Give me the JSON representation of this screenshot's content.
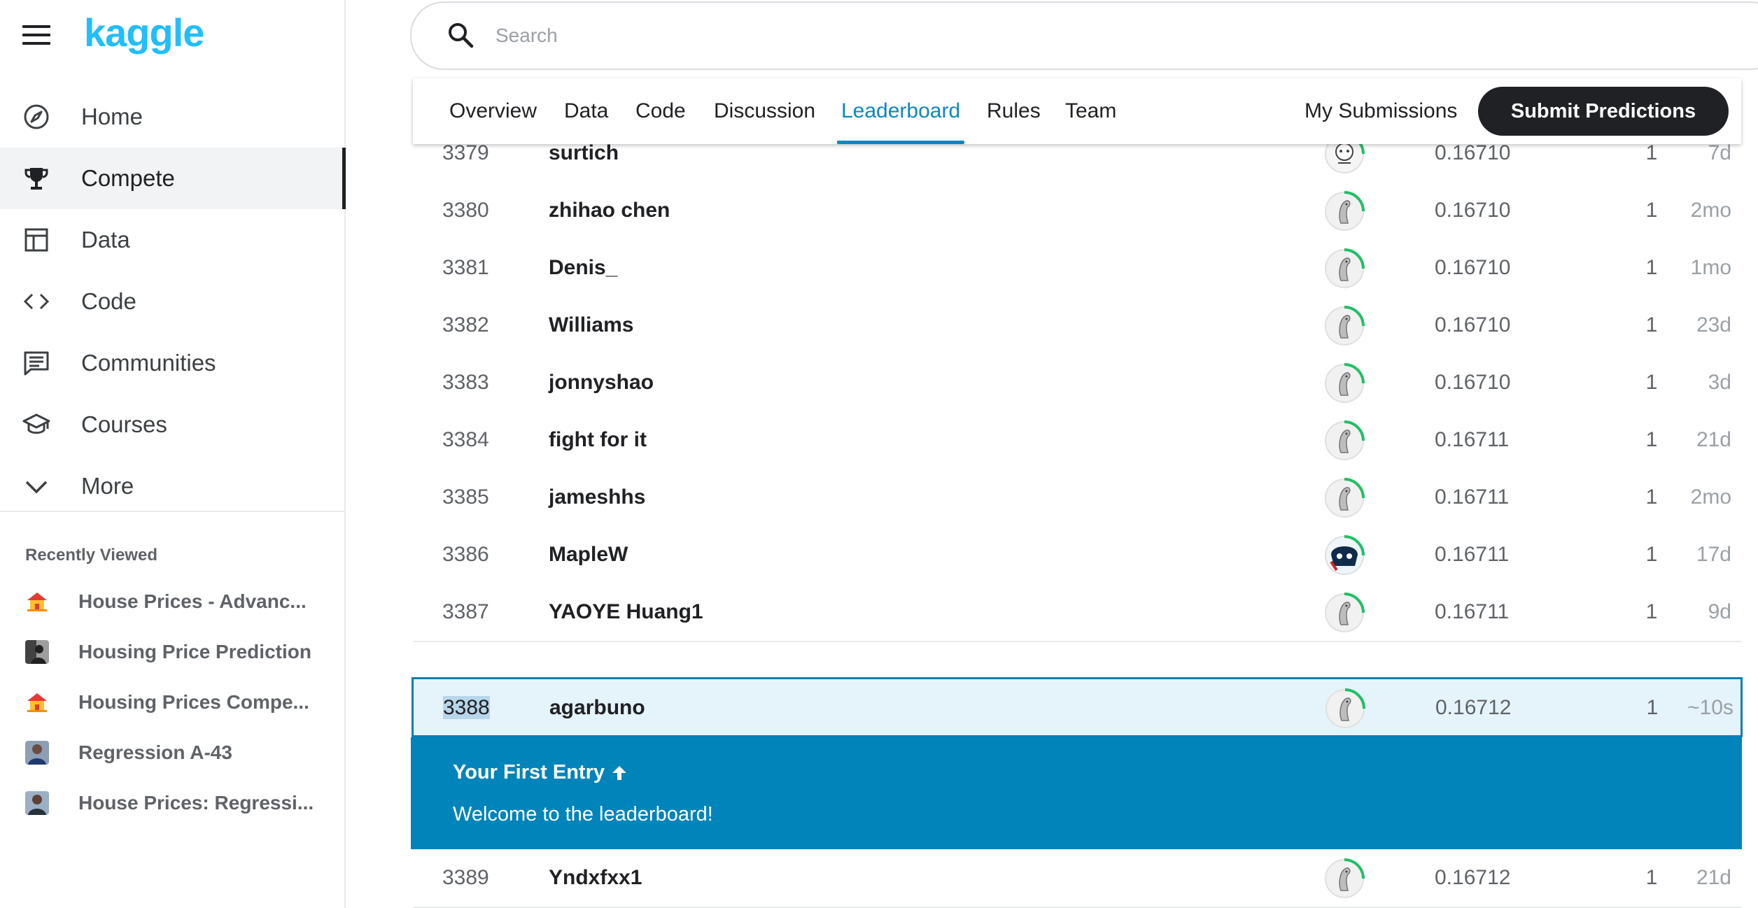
{
  "brand": {
    "logo_text": "kaggle",
    "accent": "#20beff"
  },
  "nav": {
    "items": [
      {
        "label": "Home",
        "icon": "compass-icon"
      },
      {
        "label": "Compete",
        "icon": "trophy-icon",
        "active": true
      },
      {
        "label": "Data",
        "icon": "table-icon"
      },
      {
        "label": "Code",
        "icon": "code-icon"
      },
      {
        "label": "Communities",
        "icon": "comment-icon"
      },
      {
        "label": "Courses",
        "icon": "school-icon"
      },
      {
        "label": "More",
        "icon": "chevron-down-icon"
      }
    ]
  },
  "recent": {
    "header": "Recently Viewed",
    "items": [
      {
        "label": "House Prices - Advanc..."
      },
      {
        "label": "Housing Price Prediction"
      },
      {
        "label": "Housing Prices Compe..."
      },
      {
        "label": "Regression A-43"
      },
      {
        "label": "House Prices: Regressi..."
      }
    ]
  },
  "search": {
    "placeholder": "Search"
  },
  "tabs": {
    "items": [
      {
        "label": "Overview"
      },
      {
        "label": "Data"
      },
      {
        "label": "Code"
      },
      {
        "label": "Discussion"
      },
      {
        "label": "Leaderboard",
        "active": true
      },
      {
        "label": "Rules"
      },
      {
        "label": "Team"
      }
    ],
    "my_submissions": "My Submissions",
    "submit": "Submit Predictions"
  },
  "leaderboard": {
    "rows": [
      {
        "rank": "3379",
        "team": "surtich",
        "score": "0.16710",
        "entries": "1",
        "last": "7d"
      },
      {
        "rank": "3380",
        "team": "zhihao chen",
        "score": "0.16710",
        "entries": "1",
        "last": "2mo"
      },
      {
        "rank": "3381",
        "team": "Denis_",
        "score": "0.16710",
        "entries": "1",
        "last": "1mo"
      },
      {
        "rank": "3382",
        "team": "Williams",
        "score": "0.16710",
        "entries": "1",
        "last": "23d"
      },
      {
        "rank": "3383",
        "team": "jonnyshao",
        "score": "0.16710",
        "entries": "1",
        "last": "3d"
      },
      {
        "rank": "3384",
        "team": "fight for it",
        "score": "0.16711",
        "entries": "1",
        "last": "21d"
      },
      {
        "rank": "3385",
        "team": "jameshhs",
        "score": "0.16711",
        "entries": "1",
        "last": "2mo"
      },
      {
        "rank": "3386",
        "team": "MapleW",
        "score": "0.16711",
        "entries": "1",
        "last": "17d"
      },
      {
        "rank": "3387",
        "team": "YAOYE Huang1",
        "score": "0.16711",
        "entries": "1",
        "last": "9d"
      },
      {
        "rank": "3388",
        "team": "agarbuno",
        "score": "0.16712",
        "entries": "1",
        "last": "~10s",
        "highlight": true
      },
      {
        "rank": "3389",
        "team": "Yndxfxx1",
        "score": "0.16712",
        "entries": "1",
        "last": "21d"
      }
    ],
    "first_entry": {
      "title": "Your First Entry",
      "message": "Welcome to the leaderboard!"
    }
  }
}
